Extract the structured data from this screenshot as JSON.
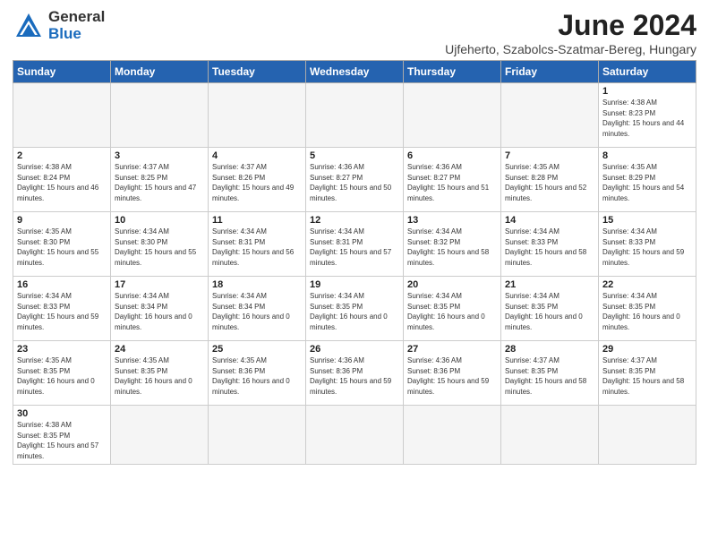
{
  "logo": {
    "text1": "General",
    "text2": "Blue"
  },
  "title": "June 2024",
  "subtitle": "Ujfeherto, Szabolcs-Szatmar-Bereg, Hungary",
  "weekdays": [
    "Sunday",
    "Monday",
    "Tuesday",
    "Wednesday",
    "Thursday",
    "Friday",
    "Saturday"
  ],
  "weeks": [
    [
      {
        "day": "",
        "info": ""
      },
      {
        "day": "",
        "info": ""
      },
      {
        "day": "",
        "info": ""
      },
      {
        "day": "",
        "info": ""
      },
      {
        "day": "",
        "info": ""
      },
      {
        "day": "",
        "info": ""
      },
      {
        "day": "1",
        "info": "Sunrise: 4:38 AM\nSunset: 8:23 PM\nDaylight: 15 hours and 44 minutes."
      }
    ],
    [
      {
        "day": "2",
        "info": "Sunrise: 4:38 AM\nSunset: 8:24 PM\nDaylight: 15 hours and 46 minutes."
      },
      {
        "day": "3",
        "info": "Sunrise: 4:37 AM\nSunset: 8:25 PM\nDaylight: 15 hours and 47 minutes."
      },
      {
        "day": "4",
        "info": "Sunrise: 4:37 AM\nSunset: 8:26 PM\nDaylight: 15 hours and 49 minutes."
      },
      {
        "day": "5",
        "info": "Sunrise: 4:36 AM\nSunset: 8:27 PM\nDaylight: 15 hours and 50 minutes."
      },
      {
        "day": "6",
        "info": "Sunrise: 4:36 AM\nSunset: 8:27 PM\nDaylight: 15 hours and 51 minutes."
      },
      {
        "day": "7",
        "info": "Sunrise: 4:35 AM\nSunset: 8:28 PM\nDaylight: 15 hours and 52 minutes."
      },
      {
        "day": "8",
        "info": "Sunrise: 4:35 AM\nSunset: 8:29 PM\nDaylight: 15 hours and 54 minutes."
      }
    ],
    [
      {
        "day": "9",
        "info": "Sunrise: 4:35 AM\nSunset: 8:30 PM\nDaylight: 15 hours and 55 minutes."
      },
      {
        "day": "10",
        "info": "Sunrise: 4:34 AM\nSunset: 8:30 PM\nDaylight: 15 hours and 55 minutes."
      },
      {
        "day": "11",
        "info": "Sunrise: 4:34 AM\nSunset: 8:31 PM\nDaylight: 15 hours and 56 minutes."
      },
      {
        "day": "12",
        "info": "Sunrise: 4:34 AM\nSunset: 8:31 PM\nDaylight: 15 hours and 57 minutes."
      },
      {
        "day": "13",
        "info": "Sunrise: 4:34 AM\nSunset: 8:32 PM\nDaylight: 15 hours and 58 minutes."
      },
      {
        "day": "14",
        "info": "Sunrise: 4:34 AM\nSunset: 8:33 PM\nDaylight: 15 hours and 58 minutes."
      },
      {
        "day": "15",
        "info": "Sunrise: 4:34 AM\nSunset: 8:33 PM\nDaylight: 15 hours and 59 minutes."
      }
    ],
    [
      {
        "day": "16",
        "info": "Sunrise: 4:34 AM\nSunset: 8:33 PM\nDaylight: 15 hours and 59 minutes."
      },
      {
        "day": "17",
        "info": "Sunrise: 4:34 AM\nSunset: 8:34 PM\nDaylight: 16 hours and 0 minutes."
      },
      {
        "day": "18",
        "info": "Sunrise: 4:34 AM\nSunset: 8:34 PM\nDaylight: 16 hours and 0 minutes."
      },
      {
        "day": "19",
        "info": "Sunrise: 4:34 AM\nSunset: 8:35 PM\nDaylight: 16 hours and 0 minutes."
      },
      {
        "day": "20",
        "info": "Sunrise: 4:34 AM\nSunset: 8:35 PM\nDaylight: 16 hours and 0 minutes."
      },
      {
        "day": "21",
        "info": "Sunrise: 4:34 AM\nSunset: 8:35 PM\nDaylight: 16 hours and 0 minutes."
      },
      {
        "day": "22",
        "info": "Sunrise: 4:34 AM\nSunset: 8:35 PM\nDaylight: 16 hours and 0 minutes."
      }
    ],
    [
      {
        "day": "23",
        "info": "Sunrise: 4:35 AM\nSunset: 8:35 PM\nDaylight: 16 hours and 0 minutes."
      },
      {
        "day": "24",
        "info": "Sunrise: 4:35 AM\nSunset: 8:35 PM\nDaylight: 16 hours and 0 minutes."
      },
      {
        "day": "25",
        "info": "Sunrise: 4:35 AM\nSunset: 8:36 PM\nDaylight: 16 hours and 0 minutes."
      },
      {
        "day": "26",
        "info": "Sunrise: 4:36 AM\nSunset: 8:36 PM\nDaylight: 15 hours and 59 minutes."
      },
      {
        "day": "27",
        "info": "Sunrise: 4:36 AM\nSunset: 8:36 PM\nDaylight: 15 hours and 59 minutes."
      },
      {
        "day": "28",
        "info": "Sunrise: 4:37 AM\nSunset: 8:35 PM\nDaylight: 15 hours and 58 minutes."
      },
      {
        "day": "29",
        "info": "Sunrise: 4:37 AM\nSunset: 8:35 PM\nDaylight: 15 hours and 58 minutes."
      }
    ],
    [
      {
        "day": "30",
        "info": "Sunrise: 4:38 AM\nSunset: 8:35 PM\nDaylight: 15 hours and 57 minutes."
      },
      {
        "day": "",
        "info": ""
      },
      {
        "day": "",
        "info": ""
      },
      {
        "day": "",
        "info": ""
      },
      {
        "day": "",
        "info": ""
      },
      {
        "day": "",
        "info": ""
      },
      {
        "day": "",
        "info": ""
      }
    ]
  ]
}
